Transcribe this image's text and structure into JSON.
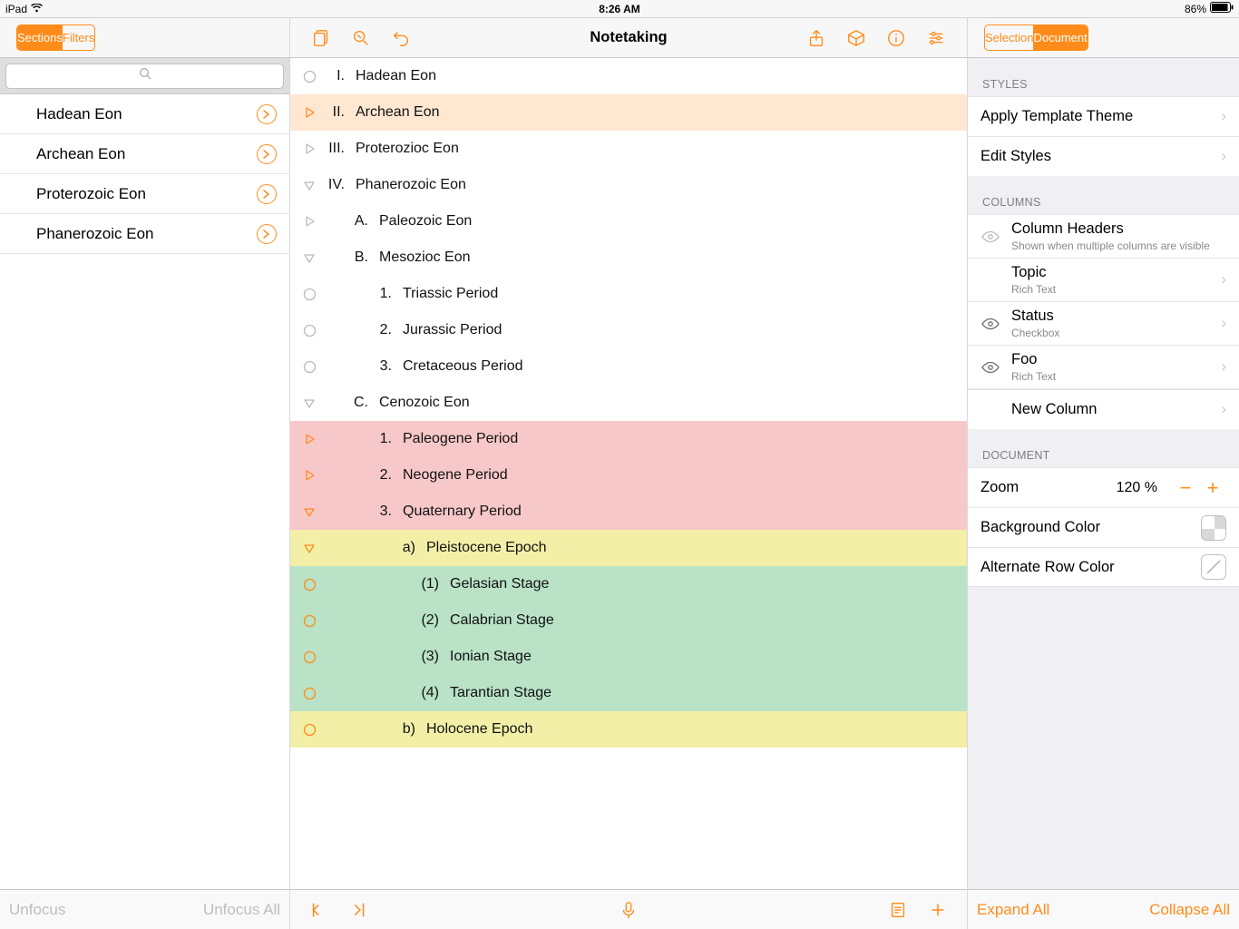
{
  "status": {
    "device": "iPad",
    "time": "8:26 AM",
    "battery": "86%"
  },
  "sidebar": {
    "tabs": {
      "sections": "Sections",
      "filters": "Filters"
    },
    "active_tab": 0,
    "search_placeholder": "",
    "items": [
      {
        "label": "Hadean Eon"
      },
      {
        "label": "Archean Eon"
      },
      {
        "label": "Proterozoic Eon"
      },
      {
        "label": "Phanerozoic Eon"
      }
    ]
  },
  "doc_title": "Notetaking",
  "outline": [
    {
      "i": 0,
      "handle": "circle",
      "num": "I.",
      "txt": "Hadean Eon",
      "bg": "none"
    },
    {
      "i": 0,
      "handle": "tri-r-o",
      "num": "II.",
      "txt": "Archean Eon",
      "bg": "sel"
    },
    {
      "i": 0,
      "handle": "tri-r",
      "num": "III.",
      "txt": "Proterozioc Eon",
      "bg": "none"
    },
    {
      "i": 0,
      "handle": "tri-d",
      "num": "IV.",
      "txt": "Phanerozoic Eon",
      "bg": "none"
    },
    {
      "i": 1,
      "handle": "tri-r",
      "num": "A.",
      "txt": "Paleozoic Eon",
      "bg": "none"
    },
    {
      "i": 1,
      "handle": "tri-d",
      "num": "B.",
      "txt": "Mesozioc Eon",
      "bg": "none"
    },
    {
      "i": 2,
      "handle": "circle",
      "num": "1.",
      "txt": "Triassic Period",
      "bg": "none"
    },
    {
      "i": 2,
      "handle": "circle",
      "num": "2.",
      "txt": "Jurassic Period",
      "bg": "none"
    },
    {
      "i": 2,
      "handle": "circle",
      "num": "3.",
      "txt": "Cretaceous Period",
      "bg": "none"
    },
    {
      "i": 1,
      "handle": "tri-d",
      "num": "C.",
      "txt": "Cenozoic Eon",
      "bg": "none"
    },
    {
      "i": 2,
      "handle": "tri-r-o",
      "num": "1.",
      "txt": "Paleogene Period",
      "bg": "pink"
    },
    {
      "i": 2,
      "handle": "tri-r-o",
      "num": "2.",
      "txt": "Neogene Period",
      "bg": "pink"
    },
    {
      "i": 2,
      "handle": "tri-d-o",
      "num": "3.",
      "txt": "Quaternary Period",
      "bg": "pink"
    },
    {
      "i": 3,
      "handle": "tri-d-o",
      "num": "a)",
      "txt": "Pleistocene Epoch",
      "bg": "yel"
    },
    {
      "i": 4,
      "handle": "circle-o",
      "num": "(1)",
      "txt": "Gelasian Stage",
      "bg": "grn"
    },
    {
      "i": 4,
      "handle": "circle-o",
      "num": "(2)",
      "txt": "Calabrian Stage",
      "bg": "grn"
    },
    {
      "i": 4,
      "handle": "circle-o",
      "num": "(3)",
      "txt": "Ionian Stage",
      "bg": "grn"
    },
    {
      "i": 4,
      "handle": "circle-o",
      "num": "(4)",
      "txt": "Tarantian Stage",
      "bg": "grn"
    },
    {
      "i": 3,
      "handle": "circle-o",
      "num": "b)",
      "txt": "Holocene Epoch",
      "bg": "yel"
    }
  ],
  "bottombar_left": {
    "unfocus": "Unfocus",
    "unfocus_all": "Unfocus All"
  },
  "inspector": {
    "tabs": {
      "selection": "Selection",
      "document": "Document"
    },
    "active_tab": 1,
    "styles_header": "STYLES",
    "apply_theme": "Apply Template Theme",
    "edit_styles": "Edit Styles",
    "columns_header": "COLUMNS",
    "col_headers_title": "Column Headers",
    "col_headers_sub": "Shown when multiple columns are visible",
    "columns": [
      {
        "name": "Topic",
        "sub": "Rich Text",
        "vis": false
      },
      {
        "name": "Status",
        "sub": "Checkbox",
        "vis": true
      },
      {
        "name": "Foo",
        "sub": "Rich Text",
        "vis": true
      }
    ],
    "new_column": "New Column",
    "document_header": "DOCUMENT",
    "zoom_label": "Zoom",
    "zoom_value": "120 %",
    "bg_color_label": "Background Color",
    "alt_row_label": "Alternate Row Color",
    "expand_all": "Expand All",
    "collapse_all": "Collapse All"
  }
}
